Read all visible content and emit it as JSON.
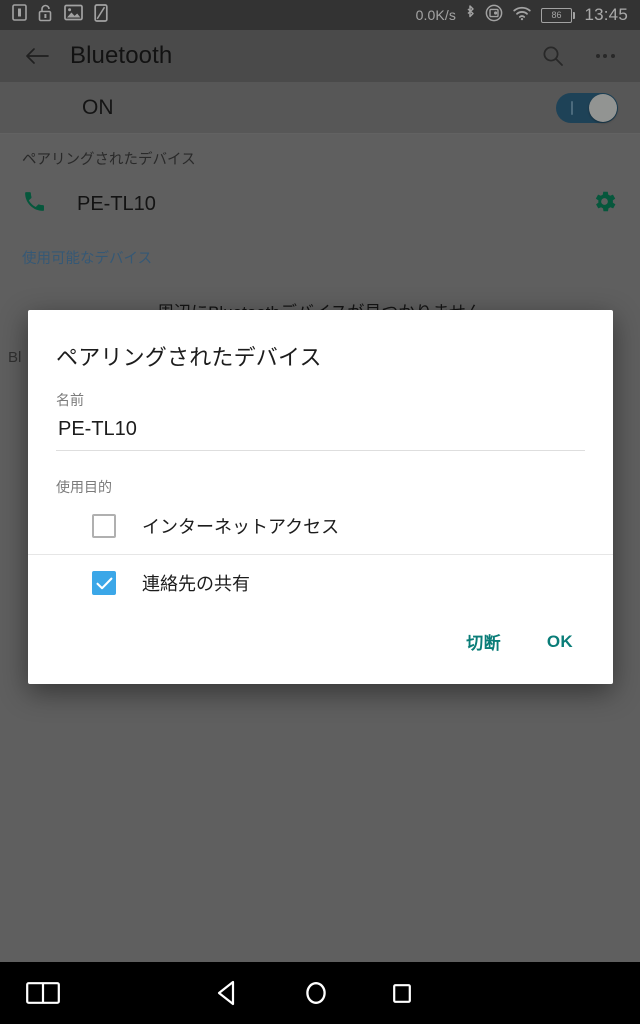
{
  "status_bar": {
    "icons": [
      "sim-card-icon",
      "unlocked-padlock-icon",
      "screenshot-image-icon",
      "sd-card-icon"
    ],
    "network_speed": "0.0K/s",
    "right_icons": [
      "bluetooth-icon",
      "data-saver-icon",
      "wifi-icon"
    ],
    "battery_level": "86",
    "clock": "13:45"
  },
  "app_bar": {
    "back_icon": "arrow-left-icon",
    "title": "Bluetooth",
    "search_icon": "search-icon",
    "overflow_icon": "overflow-menu-icon"
  },
  "bluetooth": {
    "toggle_label": "ON",
    "toggle_state": "on",
    "paired_header": "ペアリングされたデバイス",
    "paired_devices": [
      {
        "icon": "phone-handset-icon",
        "name": "PE-TL10",
        "settings_icon": "gear-icon"
      }
    ],
    "available_header": "使用可能なデバイス",
    "empty_message": "周辺にBluetoothデバイスが見つかりません",
    "background_hidden_text": "Bl"
  },
  "dialog": {
    "title": "ペアリングされたデバイス",
    "name_label": "名前",
    "name_value": "PE-TL10",
    "name_placeholder": "PE-TL10",
    "purpose_label": "使用目的",
    "options": [
      {
        "label": "インターネットアクセス",
        "checked": false
      },
      {
        "label": "連絡先の共有",
        "checked": true
      }
    ],
    "disconnect_button": "切断",
    "ok_button": "OK"
  },
  "nav_bar": {
    "split_screen_icon": "split-screen-icon",
    "back_icon": "nav-back-triangle-icon",
    "home_icon": "nav-home-circle-icon",
    "recents_icon": "nav-recents-square-icon"
  },
  "colors": {
    "accent_teal": "#0a7d78",
    "accent_blue_checkbox": "#3ba7e8",
    "switch_track": "#2c5f7d",
    "link_blue": "#4d7fa8",
    "status_bar_bg": "#4a4a4a",
    "app_bar_bg": "#6b6b6b",
    "dialog_bg": "#ffffff",
    "nav_bar_bg": "#000000"
  }
}
